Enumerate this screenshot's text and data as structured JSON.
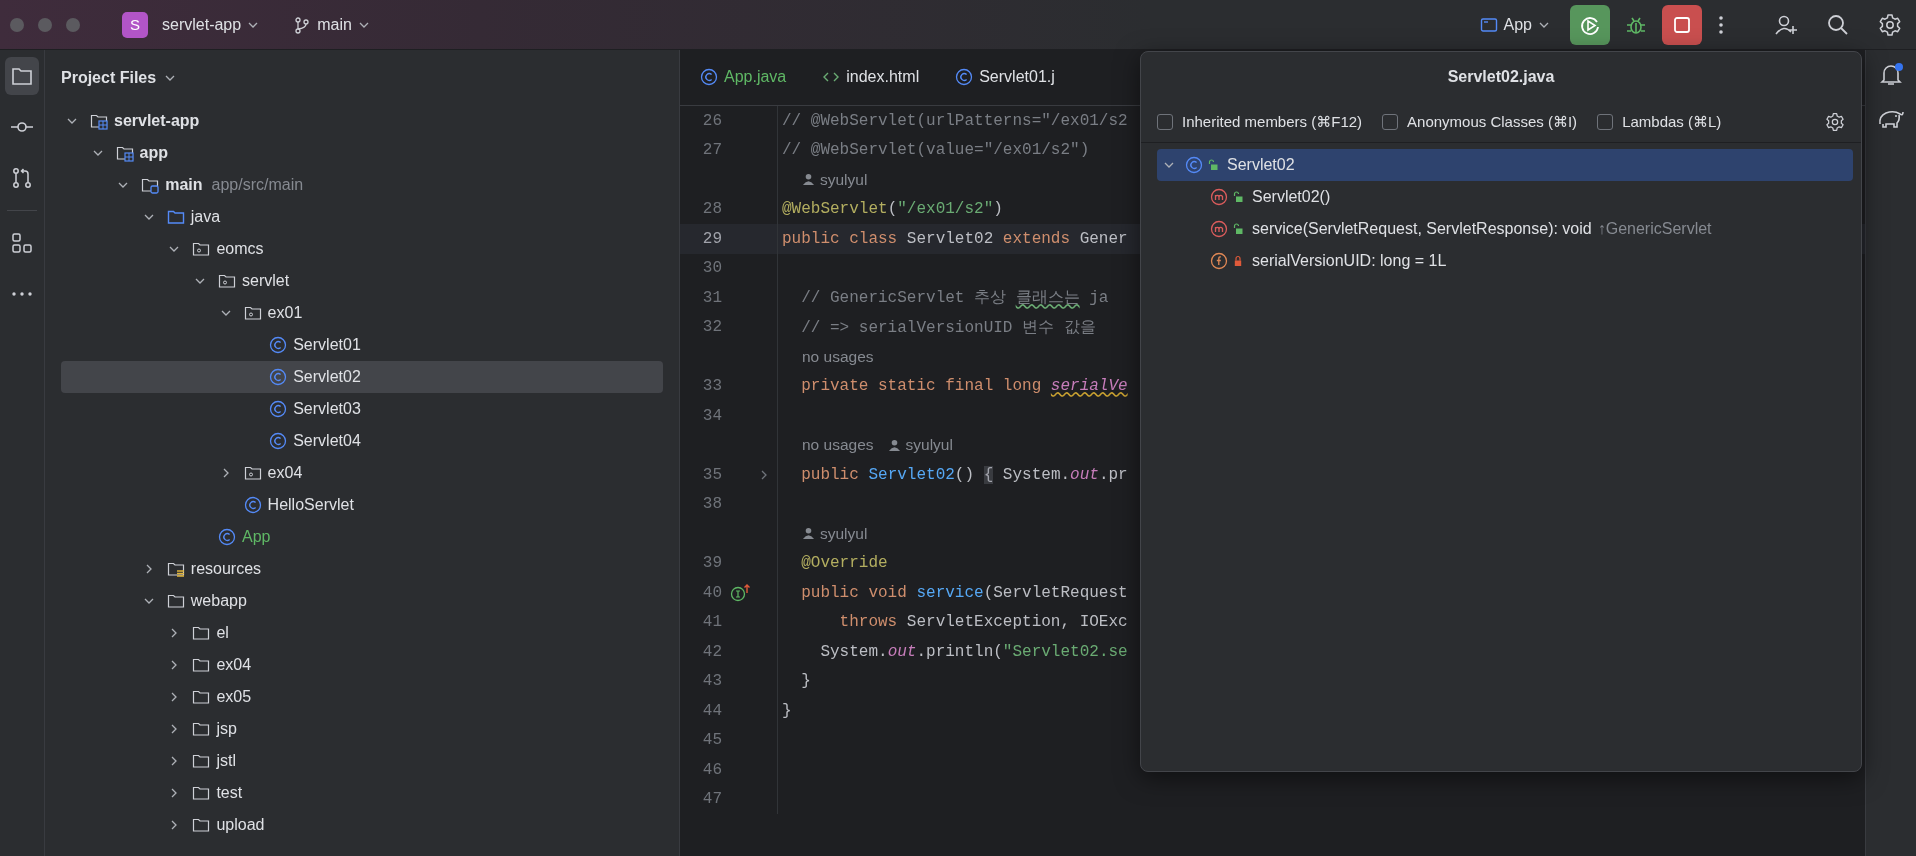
{
  "title_bar": {
    "project_badge": "S",
    "project": "servlet-app",
    "branch": "main",
    "run_config": "App"
  },
  "tool_strip": [
    {
      "kind": "project",
      "selected": true
    },
    {
      "kind": "commit",
      "selected": false
    },
    {
      "kind": "pull_requests",
      "selected": false
    },
    {
      "kind": "structure",
      "selected": false
    },
    {
      "kind": "more",
      "selected": false
    }
  ],
  "project_panel": {
    "title": "Project Files",
    "tree": [
      {
        "label": "servlet-app",
        "kind": "module",
        "expanded": true,
        "selected": false,
        "children": [
          {
            "label": "app",
            "kind": "module",
            "expanded": true,
            "selected": false,
            "children": [
              {
                "label": "main",
                "hint": "app/src/main",
                "kind": "source_set",
                "expanded": true,
                "selected": false,
                "children": [
                  {
                    "label": "java",
                    "kind": "source_folder",
                    "expanded": true,
                    "selected": false,
                    "children": [
                      {
                        "label": "eomcs",
                        "kind": "package",
                        "expanded": true,
                        "selected": false,
                        "children": [
                          {
                            "label": "servlet",
                            "kind": "package",
                            "expanded": true,
                            "selected": false,
                            "children": [
                              {
                                "label": "ex01",
                                "kind": "package",
                                "expanded": true,
                                "selected": false,
                                "children": [
                                  {
                                    "label": "Servlet01",
                                    "kind": "class",
                                    "selected": false
                                  },
                                  {
                                    "label": "Servlet02",
                                    "kind": "class",
                                    "selected": true
                                  },
                                  {
                                    "label": "Servlet03",
                                    "kind": "class",
                                    "selected": false
                                  },
                                  {
                                    "label": "Servlet04",
                                    "kind": "class",
                                    "selected": false
                                  }
                                ]
                              },
                              {
                                "label": "ex04",
                                "kind": "package",
                                "expanded": false,
                                "selected": false
                              },
                              {
                                "label": "HelloServlet",
                                "kind": "class",
                                "selected": false
                              }
                            ]
                          },
                          {
                            "label": "App",
                            "kind": "class",
                            "color": "#5fb865",
                            "selected": false
                          }
                        ]
                      }
                    ]
                  },
                  {
                    "label": "resources",
                    "kind": "resources",
                    "expanded": false,
                    "selected": false
                  },
                  {
                    "label": "webapp",
                    "kind": "folder",
                    "expanded": true,
                    "selected": false,
                    "children": [
                      {
                        "label": "el",
                        "kind": "folder",
                        "expanded": false,
                        "selected": false
                      },
                      {
                        "label": "ex04",
                        "kind": "folder",
                        "expanded": false,
                        "selected": false
                      },
                      {
                        "label": "ex05",
                        "kind": "folder",
                        "expanded": false,
                        "selected": false
                      },
                      {
                        "label": "jsp",
                        "kind": "folder",
                        "expanded": false,
                        "selected": false
                      },
                      {
                        "label": "jstl",
                        "kind": "folder",
                        "expanded": false,
                        "selected": false
                      },
                      {
                        "label": "test",
                        "kind": "folder",
                        "expanded": false,
                        "selected": false
                      },
                      {
                        "label": "upload",
                        "kind": "folder",
                        "expanded": false,
                        "selected": false
                      }
                    ]
                  }
                ]
              }
            ]
          }
        ]
      }
    ]
  },
  "editor": {
    "tabs": [
      {
        "label": "App.java",
        "kind": "class",
        "color": "#5fb865",
        "selected": false
      },
      {
        "label": "index.html",
        "kind": "html",
        "selected": false
      },
      {
        "label": "Servlet01.j",
        "kind": "class",
        "selected": false
      }
    ],
    "lines": [
      {
        "kind": "code",
        "number": "26",
        "current": false,
        "tokens": [
          {
            "text": "// @WebServlet(urlPatterns=\"/ex01/s2",
            "kind": "comment"
          }
        ]
      },
      {
        "kind": "code",
        "number": "27",
        "current": false,
        "tokens": [
          {
            "text": "// @WebServlet(value=\"/ex01/s2\")",
            "kind": "comment"
          }
        ]
      },
      {
        "kind": "hint",
        "items": [
          {
            "text": "syulyul",
            "kind": "author"
          }
        ]
      },
      {
        "kind": "code",
        "number": "28",
        "current": false,
        "tokens": [
          {
            "text": "@WebServlet",
            "kind": "annotation"
          },
          {
            "text": "(",
            "kind": "plain"
          },
          {
            "text": "\"/ex01/s2\"",
            "kind": "string"
          },
          {
            "text": ")",
            "kind": "plain"
          }
        ]
      },
      {
        "kind": "code",
        "number": "29",
        "current": true,
        "tokens": [
          {
            "text": "public class ",
            "kind": "keyword"
          },
          {
            "text": "Servlet02 ",
            "kind": "plain"
          },
          {
            "text": "extends ",
            "kind": "keyword"
          },
          {
            "text": "Gener",
            "kind": "plain"
          }
        ]
      },
      {
        "kind": "code",
        "number": "30",
        "current": false
      },
      {
        "kind": "code",
        "number": "31",
        "current": false,
        "tokens": [
          {
            "text": "  // GenericServlet 추상 ",
            "kind": "comment"
          },
          {
            "text": "클래스는",
            "kind": "comment_typo"
          },
          {
            "text": " ja",
            "kind": "comment"
          }
        ]
      },
      {
        "kind": "code",
        "number": "32",
        "current": false,
        "tokens": [
          {
            "text": "  // => serialVersionUID 변수 값을",
            "kind": "comment"
          }
        ]
      },
      {
        "kind": "hint",
        "items": [
          {
            "text": "no usages",
            "kind": "usages"
          }
        ]
      },
      {
        "kind": "code",
        "number": "33",
        "current": false,
        "tokens": [
          {
            "text": "  private static final long ",
            "kind": "keyword"
          },
          {
            "text": "serialVe",
            "kind": "static_warn"
          }
        ]
      },
      {
        "kind": "code",
        "number": "34",
        "current": false
      },
      {
        "kind": "hint",
        "items": [
          {
            "text": "no usages",
            "kind": "usages"
          },
          {
            "text": "syulyul",
            "kind": "author"
          }
        ]
      },
      {
        "kind": "code",
        "number": "35",
        "current": false,
        "foldable": true,
        "tokens": [
          {
            "text": "  public ",
            "kind": "keyword"
          },
          {
            "text": "Servlet02",
            "kind": "method"
          },
          {
            "text": "() ",
            "kind": "plain"
          },
          {
            "text": "{",
            "kind": "folded"
          },
          {
            "text": " System.",
            "kind": "plain"
          },
          {
            "text": "out",
            "kind": "static"
          },
          {
            "text": ".pr",
            "kind": "plain"
          }
        ]
      },
      {
        "kind": "code",
        "number": "38",
        "current": false
      },
      {
        "kind": "hint",
        "items": [
          {
            "text": "syulyul",
            "kind": "author"
          }
        ]
      },
      {
        "kind": "code",
        "number": "39",
        "current": false,
        "tokens": [
          {
            "text": "  @Override",
            "kind": "annotation"
          }
        ]
      },
      {
        "kind": "code",
        "number": "40",
        "current": false,
        "implements": true,
        "tokens": [
          {
            "text": "  public void ",
            "kind": "keyword"
          },
          {
            "text": "service",
            "kind": "method"
          },
          {
            "text": "(ServletRequest",
            "kind": "plain"
          }
        ]
      },
      {
        "kind": "code",
        "number": "41",
        "current": false,
        "tokens": [
          {
            "text": "      throws ",
            "kind": "keyword"
          },
          {
            "text": "ServletException, IOExc",
            "kind": "plain"
          }
        ]
      },
      {
        "kind": "code",
        "number": "42",
        "current": false,
        "tokens": [
          {
            "text": "    System.",
            "kind": "plain"
          },
          {
            "text": "out",
            "kind": "static"
          },
          {
            "text": ".println(",
            "kind": "plain"
          },
          {
            "text": "\"Servlet02.se",
            "kind": "string"
          }
        ]
      },
      {
        "kind": "code",
        "number": "43",
        "current": false,
        "tokens": [
          {
            "text": "  }",
            "kind": "plain"
          }
        ]
      },
      {
        "kind": "code",
        "number": "44",
        "current": false,
        "tokens": [
          {
            "text": "}",
            "kind": "plain"
          }
        ]
      },
      {
        "kind": "code",
        "number": "45",
        "current": false
      },
      {
        "kind": "code",
        "number": "46",
        "current": false
      },
      {
        "kind": "code",
        "number": "47",
        "current": false
      }
    ]
  },
  "structure_popup": {
    "title": "Servlet02.java",
    "options": [
      {
        "label": "Inherited members (⌘F12)",
        "checked": false
      },
      {
        "label": "Anonymous Classes (⌘I)",
        "checked": false
      },
      {
        "label": "Lambdas (⌘L)",
        "checked": false
      }
    ],
    "tree": [
      {
        "label": "Servlet02",
        "kind": "class",
        "private": false,
        "expanded": true,
        "selected": true,
        "children": [
          {
            "label": "Servlet02()",
            "kind": "method",
            "private": false,
            "selected": false
          },
          {
            "label": "service(ServletRequest, ServletResponse): void",
            "hint": "↑GenericServlet",
            "kind": "method",
            "private": false,
            "selected": false
          },
          {
            "label": "serialVersionUID: long = 1L",
            "kind": "field",
            "private": true,
            "selected": false
          }
        ]
      }
    ]
  },
  "right_strip": {
    "notifications_unread": true
  }
}
